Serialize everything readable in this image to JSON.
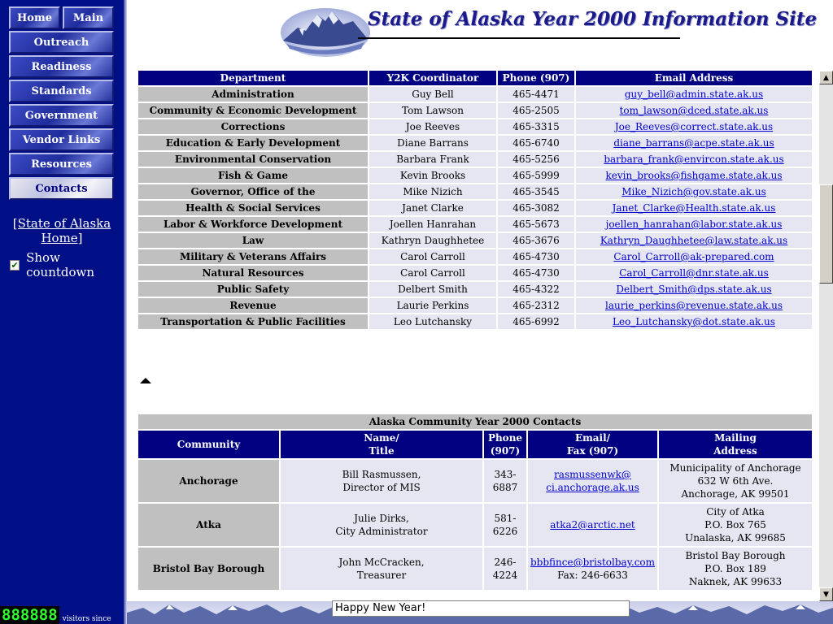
{
  "nav": {
    "buttons": [
      "Home",
      "Main",
      "Outreach",
      "Readiness",
      "Standards",
      "Government",
      "Vendor Links",
      "Resources",
      "Contacts"
    ],
    "active": "Contacts",
    "home_link": "[State of Alaska Home]",
    "countdown_label": "Show countdown",
    "countdown_checked": true,
    "counter_digits": "888888",
    "counter_text": "visitors since"
  },
  "header": {
    "title": "State of Alaska Year 2000 Information Site"
  },
  "dept_table": {
    "headers": [
      "Department",
      "Y2K Coordinator",
      "Phone (907)",
      "Email Address"
    ],
    "rows": [
      [
        "Administration",
        "Guy Bell",
        "465-4471",
        "guy_bell@admin.state.ak.us"
      ],
      [
        "Community & Economic Development",
        "Tom Lawson",
        "465-2505",
        "tom_lawson@dced.state.ak.us"
      ],
      [
        "Corrections",
        "Joe Reeves",
        "465-3315",
        "Joe_Reeves@correct.state.ak.us"
      ],
      [
        "Education & Early Development",
        "Diane Barrans",
        "465-6740",
        "diane_barrans@acpe.state.ak.us"
      ],
      [
        "Environmental Conservation",
        "Barbara Frank",
        "465-5256",
        "barbara_frank@envircon.state.ak.us"
      ],
      [
        "Fish & Game",
        "Kevin Brooks",
        "465-5999",
        "kevin_brooks@fishgame.state.ak.us"
      ],
      [
        "Governor, Office of the",
        "Mike Nizich",
        "465-3545",
        "Mike_Nizich@gov.state.ak.us"
      ],
      [
        "Health & Social Services",
        "Janet Clarke",
        "465-3082",
        "Janet_Clarke@Health.state.ak.us"
      ],
      [
        "Labor & Workforce Development",
        "Joellen Hanrahan",
        "465-5673",
        "joellen_hanrahan@labor.state.ak.us"
      ],
      [
        "Law",
        "Kathryn Daughhetee",
        "465-3676",
        "Kathryn_Daughhetee@law.state.ak.us"
      ],
      [
        "Military & Veterans Affairs",
        "Carol Carroll",
        "465-4730",
        "Carol_Carroll@ak-prepared.com"
      ],
      [
        "Natural Resources",
        "Carol Carroll",
        "465-4730",
        "Carol_Carroll@dnr.state.ak.us"
      ],
      [
        "Public Safety",
        "Delbert Smith",
        "465-4322",
        "Delbert_Smith@dps.state.ak.us"
      ],
      [
        "Revenue",
        "Laurie Perkins",
        "465-2312",
        "laurie_perkins@revenue.state.ak.us"
      ],
      [
        "Transportation & Public Facilities",
        "Leo Lutchansky",
        "465-6992",
        "Leo_Lutchansky@dot.state.ak.us"
      ]
    ]
  },
  "community_table": {
    "caption": "Alaska Community Year 2000 Contacts",
    "headers": [
      [
        "Community"
      ],
      [
        "Name/",
        "Title"
      ],
      [
        "Phone",
        "(907)"
      ],
      [
        "Email/",
        "Fax (907)"
      ],
      [
        "Mailing",
        "Address"
      ]
    ],
    "rows": [
      {
        "community": "Anchorage",
        "name": [
          "Bill Rasmussen,",
          "Director of MIS"
        ],
        "phone": "343-6887",
        "email": [
          "rasmussenwk@",
          "ci.anchorage.ak.us"
        ],
        "fax": "",
        "address": [
          "Municipality of Anchorage",
          "632 W 6th Ave.",
          "Anchorage, AK 99501"
        ]
      },
      {
        "community": "Atka",
        "name": [
          "Julie Dirks,",
          "City Administrator"
        ],
        "phone": "581-6226",
        "email": [
          "atka2@arctic.net"
        ],
        "fax": "",
        "address": [
          "City of Atka",
          "P.O. Box 765",
          "Unalaska, AK 99685"
        ]
      },
      {
        "community": "Bristol Bay Borough",
        "name": [
          "John McCracken,",
          "Treasurer"
        ],
        "phone": "246-4224",
        "email": [
          "bbbfince@bristolbay.com"
        ],
        "fax": "Fax: 246-6633",
        "address": [
          "Bristol Bay Borough",
          "P.O. Box 189",
          "Naknek, AK 99633"
        ]
      }
    ]
  },
  "status_box": "Happy New Year!"
}
